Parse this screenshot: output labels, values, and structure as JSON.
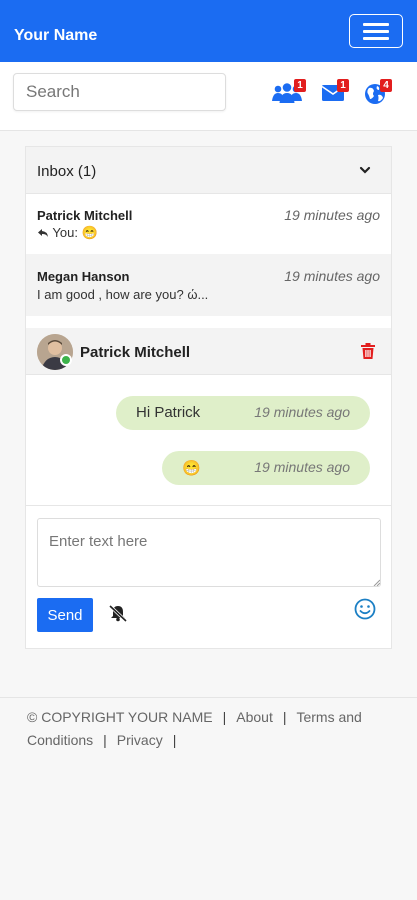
{
  "navbar": {
    "brand": "Your Name"
  },
  "search": {
    "placeholder": "Search"
  },
  "notifications": {
    "friends_count": "1",
    "messages_count": "1",
    "global_count": "4"
  },
  "inbox": {
    "title": "Inbox (1)",
    "conversations": [
      {
        "name": "Patrick Mitchell",
        "time": "19 minutes ago",
        "preview_prefix": "You:",
        "preview": "😁"
      },
      {
        "name": "Megan Hanson",
        "time": "19 minutes ago",
        "preview": "I am good , how are you? ώ..."
      }
    ]
  },
  "chat": {
    "contact_name": "Patrick Mitchell",
    "messages": [
      {
        "text": "Hi Patrick",
        "time": "19 minutes ago"
      },
      {
        "text": "😁",
        "time": "19 minutes ago"
      }
    ],
    "input_placeholder": "Enter text here",
    "send_label": "Send"
  },
  "footer": {
    "copyright": "© COPYRIGHT YOUR NAME",
    "links": [
      "About",
      "Terms and Conditions",
      "Privacy"
    ],
    "separator": "|"
  },
  "colors": {
    "brand_blue": "#1b6cf2",
    "badge_red": "#e21e1e",
    "bubble_green": "#dfefc9",
    "trash_red": "#e21e1e",
    "online_green": "#3cb34a"
  },
  "icons": [
    "menu-icon",
    "friends-icon",
    "envelope-icon",
    "globe-icon",
    "chevron-down-icon",
    "reply-icon",
    "trash-icon",
    "bell-slash-icon",
    "smile-icon",
    "resize-grip-icon"
  ]
}
